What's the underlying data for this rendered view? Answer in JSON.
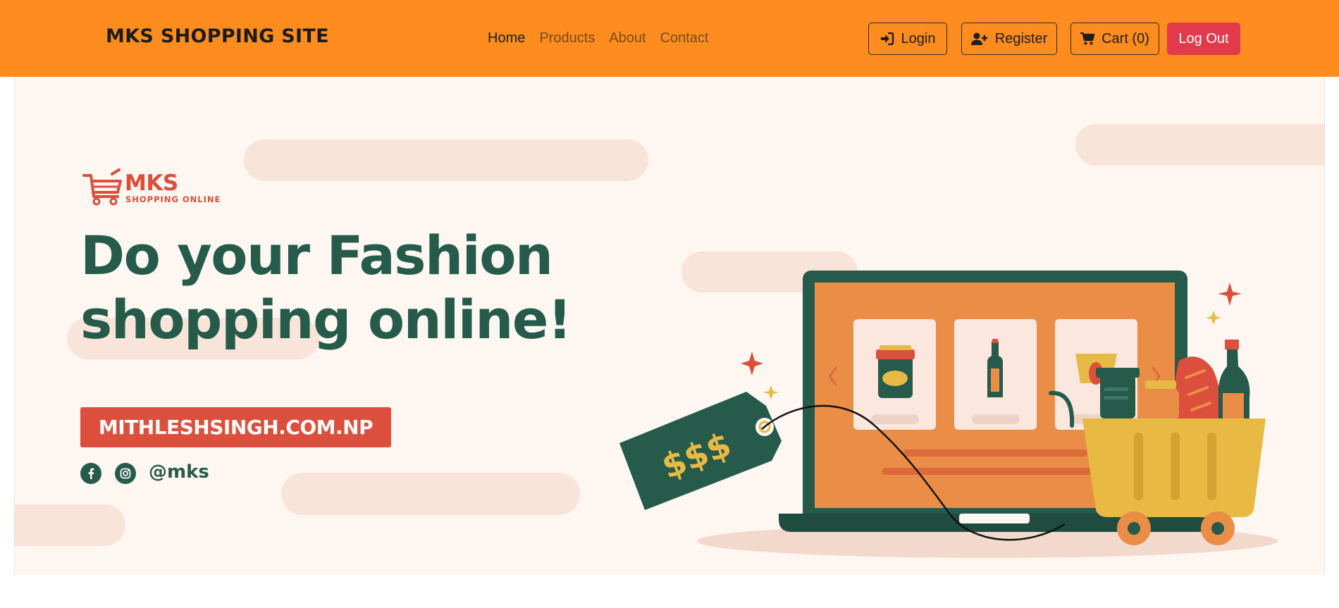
{
  "navbar": {
    "brand": "MKS SHOPPING SITE",
    "links": [
      {
        "label": "Home",
        "active": true
      },
      {
        "label": "Products"
      },
      {
        "label": "About"
      },
      {
        "label": "Contact"
      }
    ],
    "buttons": {
      "login": "Login",
      "register": "Register",
      "cart": "Cart (0)",
      "logout": "Log Out"
    },
    "icons": {
      "login": "sign-in-icon",
      "register": "user-plus-icon",
      "cart": "shopping-cart-icon"
    },
    "colors": {
      "background": "#ff8c1f",
      "logout": "#e2394b"
    }
  },
  "hero": {
    "logo": {
      "name": "MKS",
      "tagline": "SHOPPING ONLINE"
    },
    "headline_line1": "Do your Fashion",
    "headline_line2": "shopping online!",
    "site_button": "MITHLESHSINGH.COM.NP",
    "social": {
      "icons": [
        "facebook-icon",
        "instagram-icon"
      ],
      "handle": "@mks"
    },
    "illustration": {
      "price_tag_text": "$$$",
      "icons": [
        "laptop-icon",
        "price-tag-icon",
        "shopping-basket-icon"
      ]
    },
    "colors": {
      "primary": "#265a4a",
      "accent": "#dc4f3d",
      "background": "#fdf6f1"
    }
  }
}
